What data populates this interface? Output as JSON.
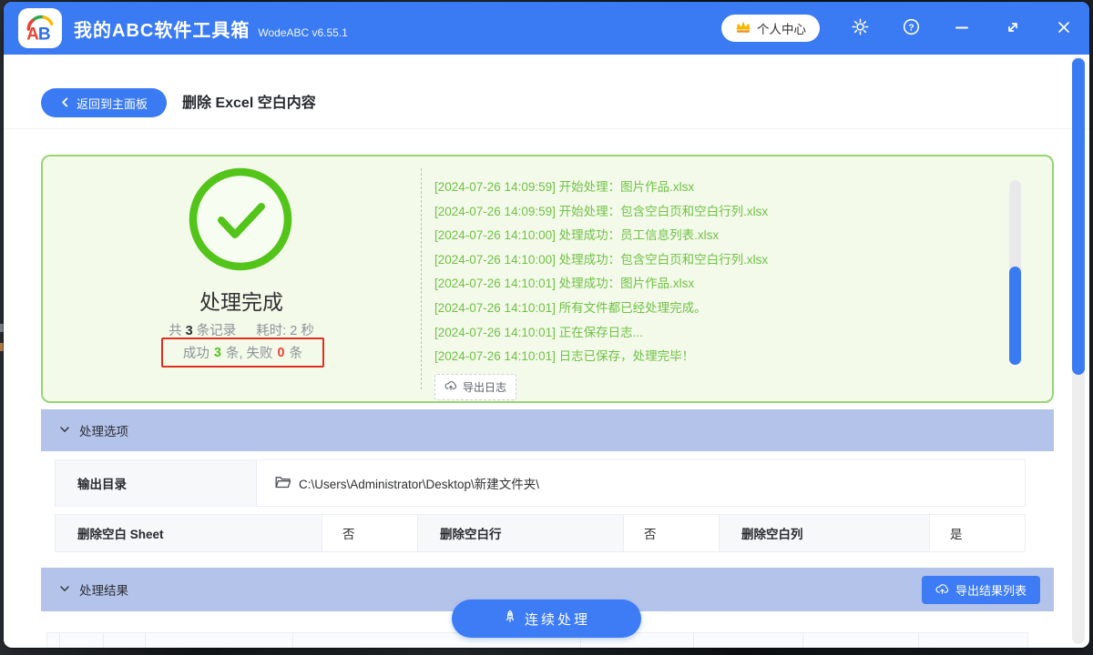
{
  "titlebar": {
    "title": "我的ABC软件工具箱",
    "version": "WodeABC v6.55.1",
    "user_center": "个人中心"
  },
  "nav": {
    "back_label": "返回到主面板",
    "page_title": "删除 Excel 空白内容"
  },
  "result_panel": {
    "status_title": "处理完成",
    "total_prefix": "共",
    "total_count": "3",
    "total_suffix": "条记录",
    "time_text": "耗时: 2 秒",
    "success_label": "成功",
    "success_count": "3",
    "middle_label": "条, 失败",
    "fail_count": "0",
    "fail_suffix": "条",
    "logs": [
      "[2024-07-26 14:09:59] 开始处理：图片作品.xlsx",
      "[2024-07-26 14:09:59] 开始处理：包含空白页和空白行列.xlsx",
      "[2024-07-26 14:10:00] 处理成功：员工信息列表.xlsx",
      "[2024-07-26 14:10:00] 处理成功：包含空白页和空白行列.xlsx",
      "[2024-07-26 14:10:01] 处理成功：图片作品.xlsx",
      "[2024-07-26 14:10:01] 所有文件都已经处理完成。",
      "[2024-07-26 14:10:01] 正在保存日志...",
      "[2024-07-26 14:10:01] 日志已保存，处理完毕！"
    ],
    "export_log_label": "导出日志"
  },
  "options_section": {
    "title": "处理选项",
    "output_dir_label": "输出目录",
    "output_dir_value": "C:\\Users\\Administrator\\Desktop\\新建文件夹\\",
    "options": [
      {
        "label": "删除空白 Sheet",
        "value": "否"
      },
      {
        "label": "删除空白行",
        "value": "否"
      },
      {
        "label": "删除空白列",
        "value": "是"
      }
    ]
  },
  "results_section": {
    "title": "处理结果",
    "export_results_label": "导出结果列表",
    "continue_label": "连续处理"
  },
  "colors": {
    "titlebar_blue": "#3a7af2",
    "accent_blue": "#3d7cf4",
    "section_header_periwinkle": "#b4c3ea",
    "success_green": "#52c41a",
    "panel_border_green": "#97d575",
    "panel_bg_green": "#f3fae9",
    "log_text_green": "#71c047",
    "fail_red": "#f04134",
    "highlight_border_red": "#e02e1f"
  }
}
